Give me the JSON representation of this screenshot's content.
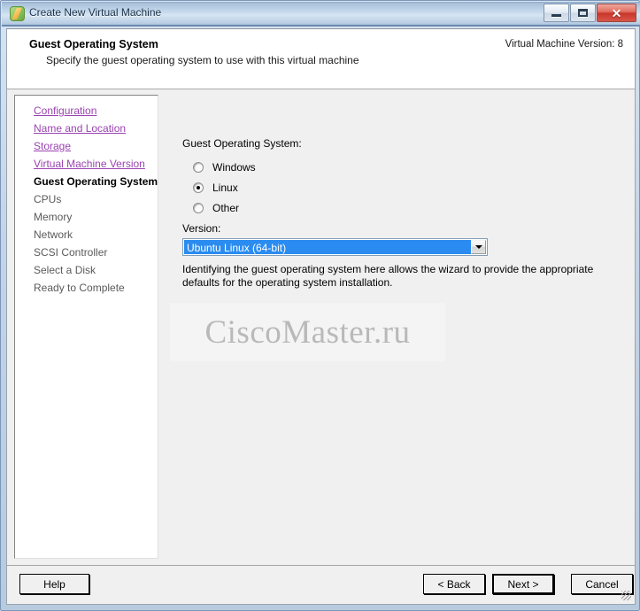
{
  "window": {
    "title": "Create New Virtual Machine",
    "app_icon": "vsphere-vm-icon",
    "controls": {
      "minimize": "minimize-icon",
      "maximize": "maximize-icon",
      "close": "✕"
    }
  },
  "header": {
    "title": "Guest Operating System",
    "subtitle": "Specify the guest operating system to use with this virtual machine",
    "version_note": "Virtual Machine Version: 8"
  },
  "sidebar": {
    "items": [
      {
        "label": "Configuration",
        "state": "done"
      },
      {
        "label": "Name and Location",
        "state": "done"
      },
      {
        "label": "Storage",
        "state": "done"
      },
      {
        "label": "Virtual Machine Version",
        "state": "done"
      },
      {
        "label": "Guest Operating System",
        "state": "current"
      },
      {
        "label": "CPUs",
        "state": "todo"
      },
      {
        "label": "Memory",
        "state": "todo"
      },
      {
        "label": "Network",
        "state": "todo"
      },
      {
        "label": "SCSI Controller",
        "state": "todo"
      },
      {
        "label": "Select a Disk",
        "state": "todo"
      },
      {
        "label": "Ready to Complete",
        "state": "todo"
      }
    ]
  },
  "main": {
    "group_label": "Guest Operating System:",
    "radios": [
      {
        "label": "Windows",
        "selected": false
      },
      {
        "label": "Linux",
        "selected": true
      },
      {
        "label": "Other",
        "selected": false
      }
    ],
    "version_label": "Version:",
    "version_value": "Ubuntu Linux (64-bit)",
    "version_options": [
      "Ubuntu Linux (64-bit)"
    ],
    "description": "Identifying the guest operating system here allows the wizard to provide the appropriate defaults for the operating system installation.",
    "watermark": "CiscoMaster.ru"
  },
  "footer": {
    "help_label": "Help",
    "back_label": "< Back",
    "next_label": "Next >",
    "cancel_label": "Cancel"
  },
  "colors": {
    "accent_selection": "#2a8cf0",
    "link": "#9a43b1",
    "titlebar": "#c9dcee",
    "close_button": "#c8352a",
    "dialog_bg": "#f0f0f0"
  }
}
